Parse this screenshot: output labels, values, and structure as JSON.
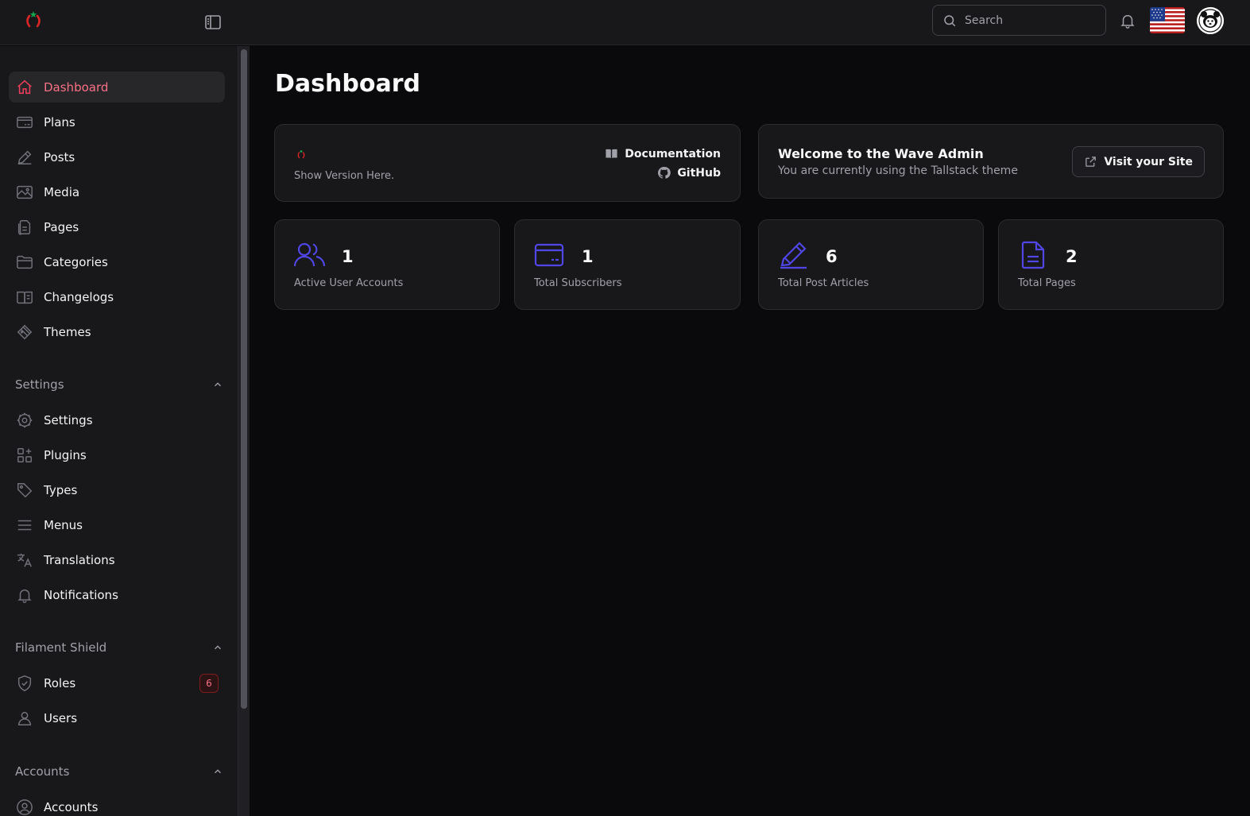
{
  "topbar": {
    "search_placeholder": "Search",
    "icons": [
      "logo-icon",
      "sidebar-collapse-icon",
      "search-icon",
      "bell-icon",
      "us-flag-icon",
      "user-avatar"
    ]
  },
  "sidebar": {
    "items": [
      {
        "label": "Dashboard",
        "icon": "home-icon",
        "active": true
      },
      {
        "label": "Plans",
        "icon": "credit-card-icon"
      },
      {
        "label": "Posts",
        "icon": "pencil-icon"
      },
      {
        "label": "Media",
        "icon": "photo-icon"
      },
      {
        "label": "Pages",
        "icon": "document-icon"
      },
      {
        "label": "Categories",
        "icon": "folder-icon"
      },
      {
        "label": "Changelogs",
        "icon": "book-icon"
      },
      {
        "label": "Themes",
        "icon": "swatch-icon"
      }
    ],
    "groups": [
      {
        "title": "Settings",
        "items": [
          {
            "label": "Settings",
            "icon": "cog-icon"
          },
          {
            "label": "Plugins",
            "icon": "puzzle-grid-icon"
          },
          {
            "label": "Types",
            "icon": "tag-icon"
          },
          {
            "label": "Menus",
            "icon": "bars-icon"
          },
          {
            "label": "Translations",
            "icon": "language-icon"
          },
          {
            "label": "Notifications",
            "icon": "bell-icon"
          }
        ]
      },
      {
        "title": "Filament Shield",
        "items": [
          {
            "label": "Roles",
            "icon": "shield-check-icon",
            "badge": "6"
          },
          {
            "label": "Users",
            "icon": "user-icon"
          }
        ]
      },
      {
        "title": "Accounts",
        "items": [
          {
            "label": "Accounts",
            "icon": "user-circle-icon"
          }
        ]
      }
    ]
  },
  "main": {
    "title": "Dashboard",
    "version_card": {
      "version_text": "Show Version Here.",
      "documentation_label": "Documentation",
      "github_label": "GitHub"
    },
    "welcome_card": {
      "title": "Welcome to the Wave Admin",
      "subtitle": "You are currently using the Tallstack theme",
      "visit_label": "Visit your Site"
    },
    "stats": [
      {
        "value": "1",
        "label": "Active User Accounts",
        "icon": "users-icon"
      },
      {
        "value": "1",
        "label": "Total Subscribers",
        "icon": "credit-card-icon"
      },
      {
        "value": "6",
        "label": "Total Post Articles",
        "icon": "pencil-icon"
      },
      {
        "value": "2",
        "label": "Total Pages",
        "icon": "document-text-icon"
      }
    ]
  },
  "colors": {
    "accent": "#fb7185",
    "stat_icon": "#4f46e5",
    "background": "#0a0a0c",
    "panel": "#18181b"
  }
}
